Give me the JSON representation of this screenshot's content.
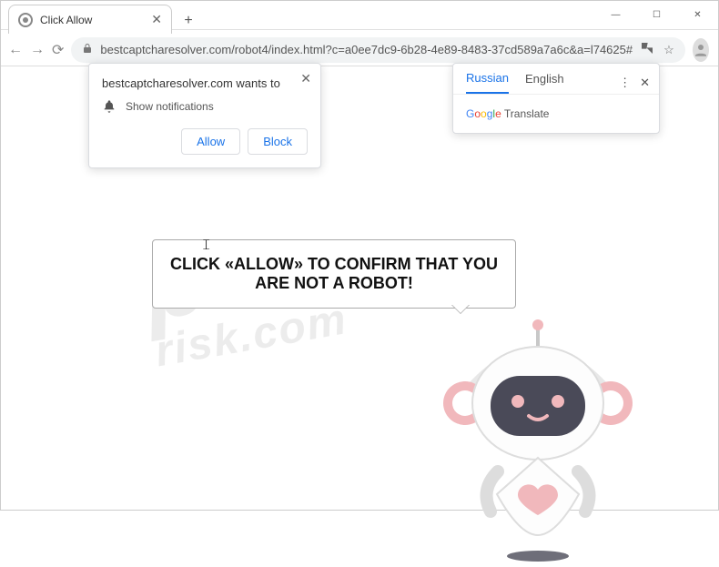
{
  "window": {
    "minimize": "—",
    "maximize": "☐",
    "close": "✕"
  },
  "tab": {
    "title": "Click Allow",
    "close": "✕",
    "new": "+"
  },
  "toolbar": {
    "back": "←",
    "forward": "→",
    "reload": "⟳",
    "url": "bestcaptcharesolver.com/robot4/index.html?c=a0ee7dc9-6b28-4e89-8483-37cd589a7a6c&a=l74625#",
    "translate_icon": "⠿",
    "star": "☆",
    "menu": "⋮"
  },
  "permission": {
    "site_wants": "bestcaptcharesolver.com wants to",
    "show_notifications": "Show notifications",
    "allow": "Allow",
    "block": "Block",
    "close": "✕"
  },
  "translate": {
    "russian": "Russian",
    "english": "English",
    "menu": "⋮",
    "close": "✕",
    "brand": "Google Translate"
  },
  "page": {
    "speech": "CLICK «ALLOW» TO CONFIRM THAT YOU ARE NOT A ROBOT!"
  },
  "watermark": {
    "main": "pc",
    "sub": "risk.com"
  },
  "colors": {
    "accent": "#1a73e8",
    "robot_face": "#4a4a58",
    "robot_pink": "#f1b8bc",
    "robot_body": "#f4f4f4"
  }
}
